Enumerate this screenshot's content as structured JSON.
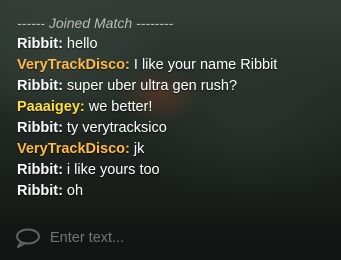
{
  "chat": {
    "system_message": "------ Joined Match --------",
    "messages": [
      {
        "sender": "Ribbit:",
        "text": " hello",
        "color": "#ffffff"
      },
      {
        "sender": "VeryTrackDisco:",
        "text": " I like your name Ribbit",
        "color": "#ffb94a"
      },
      {
        "sender": "Ribbit:",
        "text": " super uber ultra gen rush?",
        "color": "#ffffff"
      },
      {
        "sender": "Paaaigey:",
        "text": " we better!",
        "color": "#ffdf44"
      },
      {
        "sender": "Ribbit:",
        "text": " ty verytracksico",
        "color": "#ffffff"
      },
      {
        "sender": "VeryTrackDisco:",
        "text": " jk",
        "color": "#ffb94a"
      },
      {
        "sender": "Ribbit:",
        "text": " i like yours too",
        "color": "#ffffff"
      },
      {
        "sender": "Ribbit:",
        "text": " oh",
        "color": "#ffffff"
      }
    ],
    "input": {
      "placeholder": "Enter text...",
      "value": "",
      "icon": "chat-bubble-icon"
    }
  }
}
